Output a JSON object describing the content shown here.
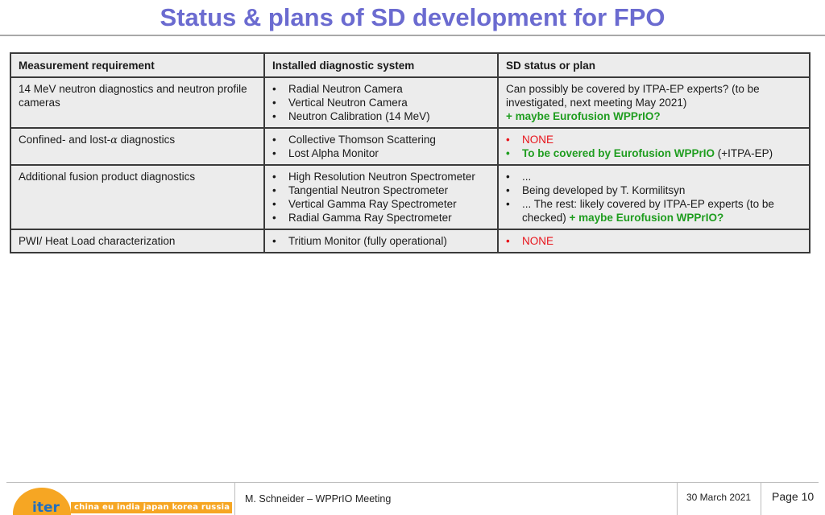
{
  "slide": {
    "title": "Status & plans of SD development for FPO"
  },
  "table": {
    "headers": [
      "Measurement requirement",
      "Installed diagnostic system",
      "SD status or plan"
    ],
    "rows": [
      {
        "requirement": "14 MeV neutron diagnostics and neutron profile cameras",
        "systems": [
          "Radial Neutron Camera",
          "Vertical Neutron Camera",
          "Neutron Calibration (14 MeV)"
        ],
        "status_text": "Can possibly be covered by ITPA-EP experts? (to be investigated, next meeting May 2021)",
        "status_green": "+ maybe Eurofusion WPPrIO?"
      },
      {
        "requirement_prefix": "Confined- and lost-",
        "requirement_symbol": "α",
        "requirement_suffix": " diagnostics",
        "systems": [
          "Collective Thomson Scattering",
          "Lost Alpha Monitor"
        ],
        "status_none": "NONE",
        "status_green": "To be covered by Eurofusion WPPrIO",
        "status_suffix": " (+ITPA-EP)"
      },
      {
        "requirement": "Additional fusion product diagnostics",
        "systems": [
          "High Resolution Neutron Spectrometer",
          "Tangential Neutron Spectrometer",
          "Vertical Gamma Ray Spectrometer",
          "Radial Gamma Ray Spectrometer"
        ],
        "status_items": [
          "...",
          "Being developed by T. Kormilitsyn"
        ],
        "status_last_text": "... The rest: likely covered by ITPA-EP experts (to be checked) ",
        "status_last_green": "+ maybe Eurofusion WPPrIO?"
      },
      {
        "requirement": "PWI/ Heat Load characterization",
        "systems": [
          "Tritium Monitor (fully operational)"
        ],
        "status_none": "NONE"
      }
    ]
  },
  "footer": {
    "logo_text": "iter",
    "logo_tagline": "china eu india japan korea russia usa",
    "meeting": "M. Schneider – WPPrIO Meeting",
    "date": "30 March 2021",
    "page": "Page 10"
  },
  "colors": {
    "title": "#6b6bd0",
    "none_red": "#e8141b",
    "highlight_green": "#1f9d1f",
    "logo_orange": "#f6a623",
    "logo_blue": "#1f6fc1"
  }
}
